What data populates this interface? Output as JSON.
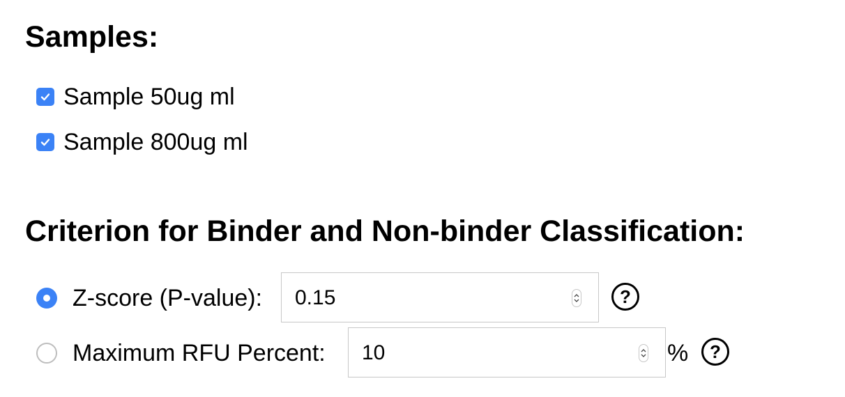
{
  "samples": {
    "heading": "Samples:",
    "items": [
      {
        "label": "Sample 50ug ml",
        "checked": true
      },
      {
        "label": "Sample 800ug ml",
        "checked": true
      }
    ]
  },
  "criterion": {
    "heading": "Criterion for Binder and Non-binder Classification:",
    "zscore": {
      "label": "Z-score (P-value):",
      "value": "0.15",
      "selected": true,
      "help": "?"
    },
    "rfu": {
      "label": "Maximum RFU Percent:",
      "value": "10",
      "unit": "%",
      "selected": false,
      "help": "?"
    }
  },
  "colors": {
    "accent": "#3b82f6"
  }
}
